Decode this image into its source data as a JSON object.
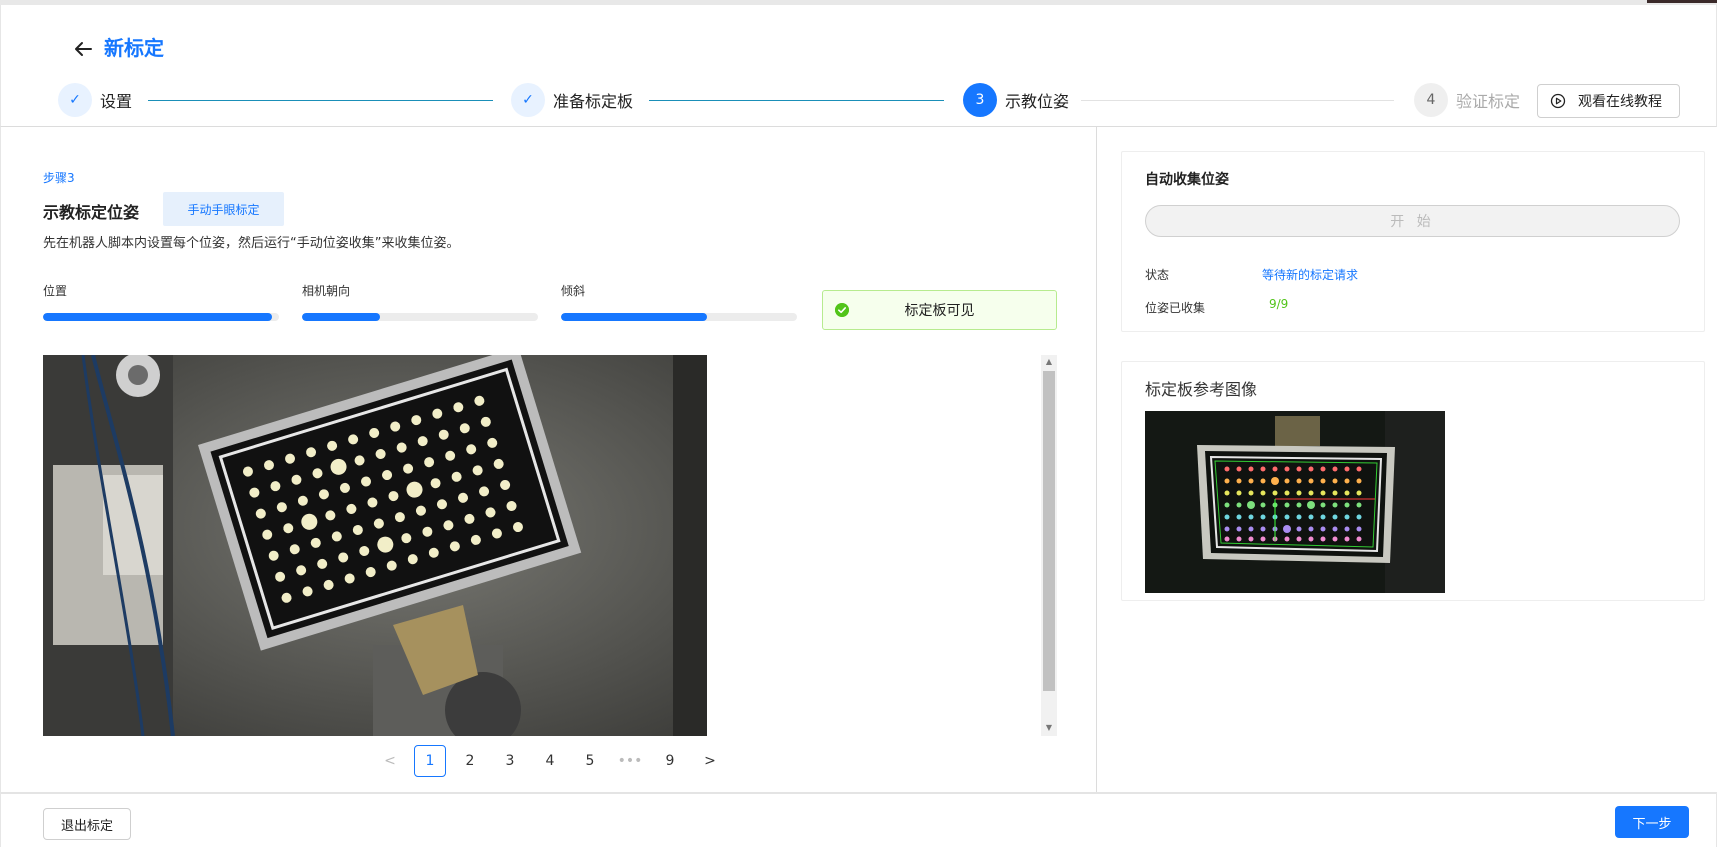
{
  "header": {
    "title": "新标定",
    "steps": [
      {
        "index": "✓",
        "label": "设置",
        "state": "done"
      },
      {
        "index": "✓",
        "label": "准备标定板",
        "state": "done"
      },
      {
        "index": "3",
        "label": "示教位姿",
        "state": "active"
      },
      {
        "index": "4",
        "label": "验证标定",
        "state": "pending"
      }
    ],
    "tutorial_label": "观看在线教程"
  },
  "main": {
    "step_tag": "步骤3",
    "section_title": "示教标定位姿",
    "mode_button": "手动手眼标定",
    "description": "先在机器人脚本内设置每个位姿，然后运行“手动位姿收集”来收集位姿。",
    "progress": [
      {
        "label": "位置",
        "percent": 97
      },
      {
        "label": "相机朝向",
        "percent": 33
      },
      {
        "label": "倾斜",
        "percent": 62
      }
    ],
    "board_visible_label": "标定板可见",
    "pagination": {
      "prev": "<",
      "pages": [
        "1",
        "2",
        "3",
        "4",
        "5"
      ],
      "ellipsis": "•••",
      "last": "9",
      "next": ">",
      "current": "1"
    }
  },
  "side": {
    "auto_title": "自动收集位姿",
    "start_label": "开 始",
    "status_label": "状态",
    "status_value": "等待新的标定请求",
    "collected_label": "位姿已收集",
    "collected_value": "9/9",
    "reference_title": "标定板参考图像"
  },
  "footer": {
    "exit_label": "退出标定",
    "next_label": "下一步"
  },
  "colors": {
    "accent": "#1677ff",
    "success": "#52c41a",
    "connector": "#1a8fb8"
  }
}
